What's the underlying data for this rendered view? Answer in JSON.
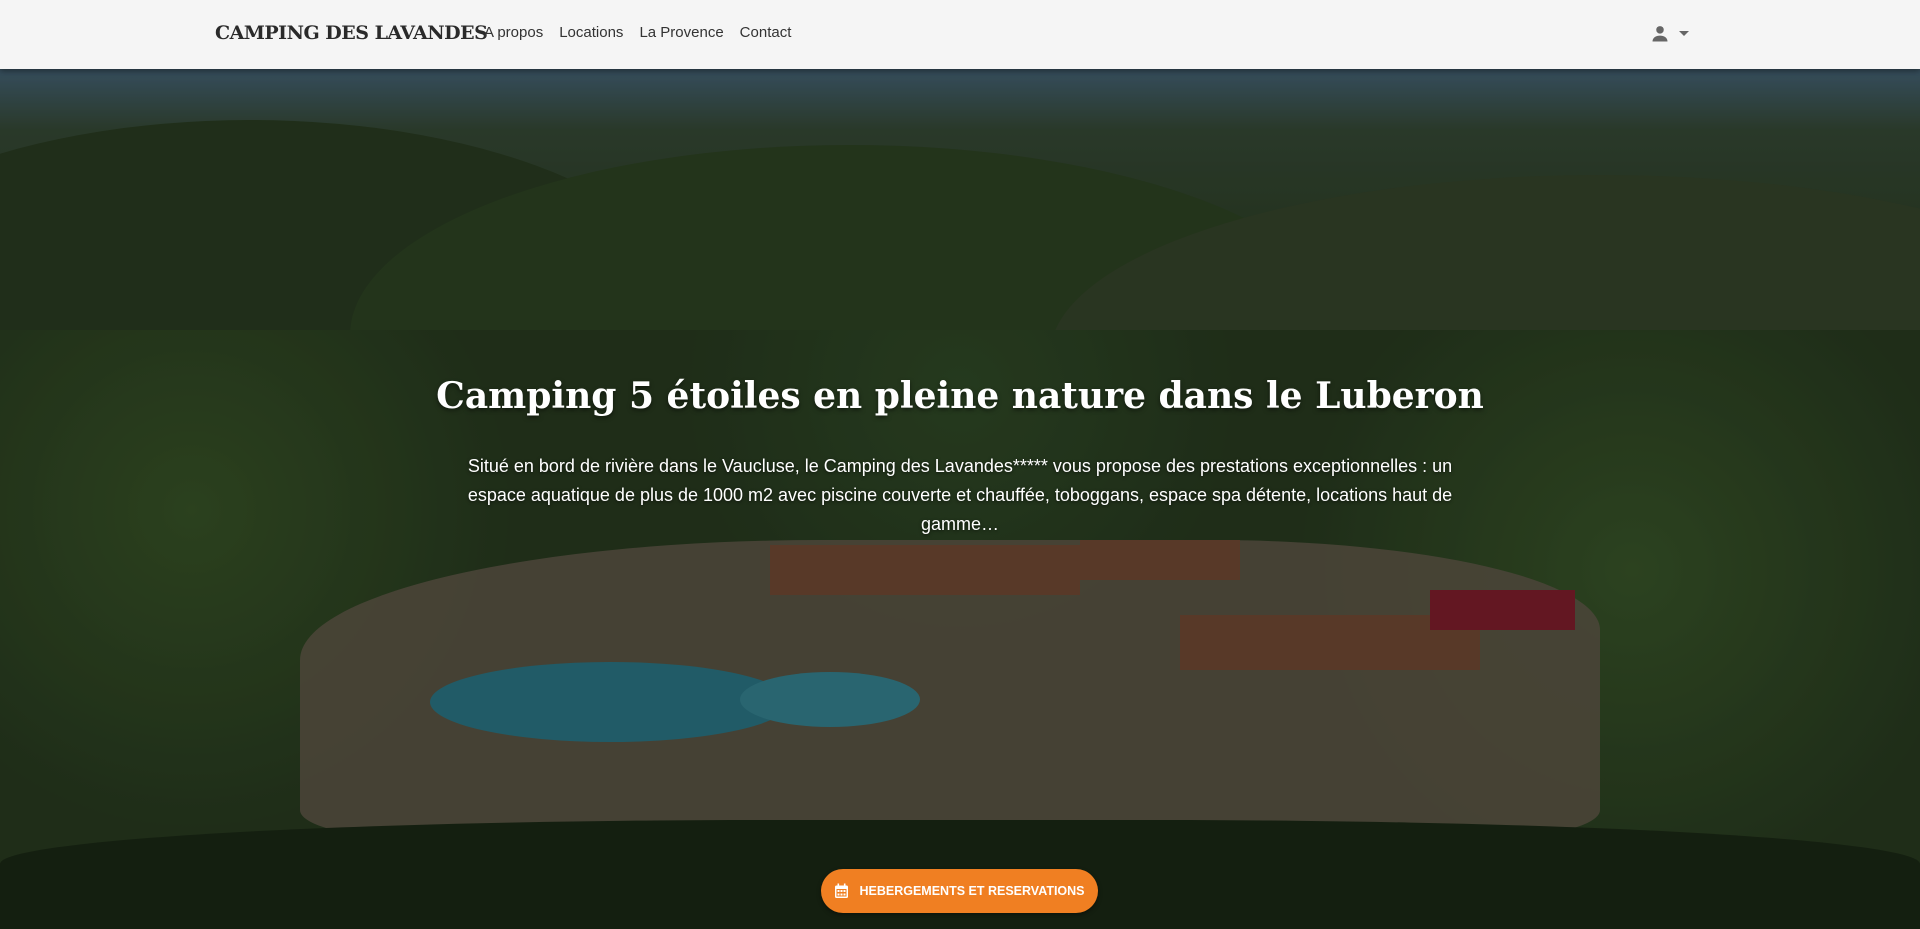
{
  "header": {
    "logo": "CAMPING DES LAVANDES",
    "nav": [
      {
        "label": "A propos"
      },
      {
        "label": "Locations"
      },
      {
        "label": "La Provence"
      },
      {
        "label": "Contact"
      }
    ],
    "user_icon": "account-icon",
    "dropdown_icon": "caret-down-icon"
  },
  "hero": {
    "title": "Camping 5 étoiles en pleine nature dans le Luberon",
    "description": "Situé en bord de rivière dans le Vaucluse, le Camping des Lavandes***** vous propose des prestations exceptionnelles : un espace aquatique de plus de 1000 m2 avec piscine couverte et chauffée, toboggans, espace spa détente, locations haut de gamme…",
    "cta_label": "HEBERGEMENTS ET RESERVATIONS",
    "cta_icon": "calendar-icon"
  },
  "colors": {
    "accent": "#f07f22",
    "header_bg": "#f5f5f5"
  }
}
